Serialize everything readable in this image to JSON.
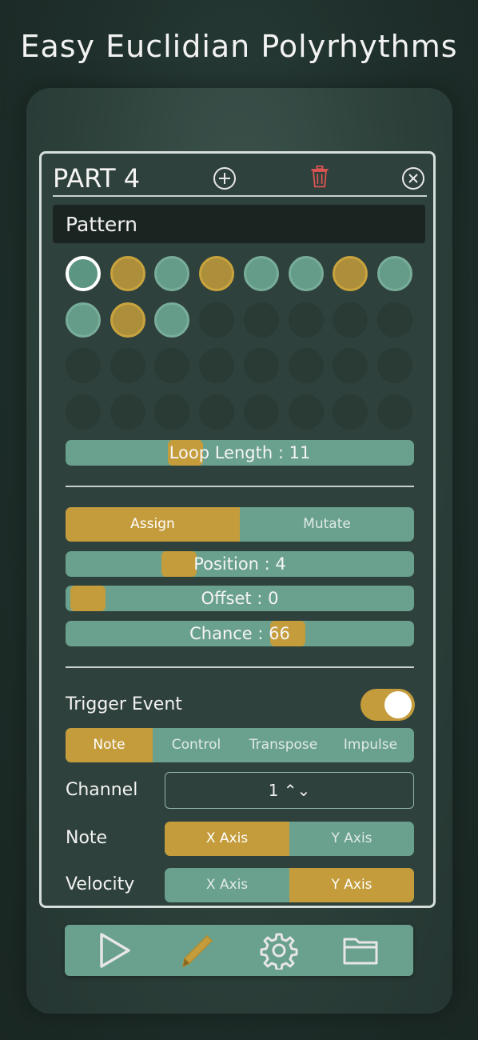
{
  "headline": "Easy Euclidian Polyrhythms",
  "part": {
    "title": "PART 4",
    "icons": {
      "add": "plus-circle-icon",
      "delete": "trash-icon",
      "close": "close-circle-icon"
    }
  },
  "pattern": {
    "section_label": "Pattern",
    "rows": [
      [
        "current",
        "gold",
        "teal",
        "gold",
        "teal",
        "teal",
        "gold",
        "teal"
      ],
      [
        "teal",
        "gold",
        "teal",
        "empty",
        "empty",
        "empty",
        "empty",
        "empty"
      ],
      [
        "empty",
        "empty",
        "empty",
        "empty",
        "empty",
        "empty",
        "empty",
        "empty"
      ],
      [
        "empty",
        "empty",
        "empty",
        "empty",
        "empty",
        "empty",
        "empty",
        "empty"
      ]
    ],
    "loop_length": {
      "label": "Loop Length : 11",
      "value": 11,
      "max": 32
    }
  },
  "mode": {
    "options": [
      "Assign",
      "Mutate"
    ],
    "selected": "Assign"
  },
  "position": {
    "label": "Position : 4",
    "value": 4,
    "max": 11
  },
  "offset": {
    "label": "Offset : 0",
    "value": 0
  },
  "chance": {
    "label": "Chance : 66",
    "value": 66,
    "max": 100
  },
  "trigger": {
    "label": "Trigger Event",
    "enabled": true,
    "types": [
      "Note",
      "Control",
      "Transpose",
      "Impulse"
    ],
    "selected": "Note"
  },
  "channel": {
    "label": "Channel",
    "value": "1 ⌃⌄"
  },
  "note": {
    "label": "Note",
    "options": [
      "X Axis",
      "Y Axis"
    ],
    "selected": "X Axis"
  },
  "velocity": {
    "label": "Velocity",
    "options": [
      "X Axis",
      "Y Axis"
    ],
    "selected": "Y Axis"
  },
  "toolbar": {
    "icons": [
      "play-icon",
      "pencil-icon",
      "gear-icon",
      "folder-icon"
    ]
  },
  "colors": {
    "teal": "#6aa08e",
    "gold": "#c49c3b",
    "danger": "#e05454",
    "panel": "#2f413c"
  }
}
